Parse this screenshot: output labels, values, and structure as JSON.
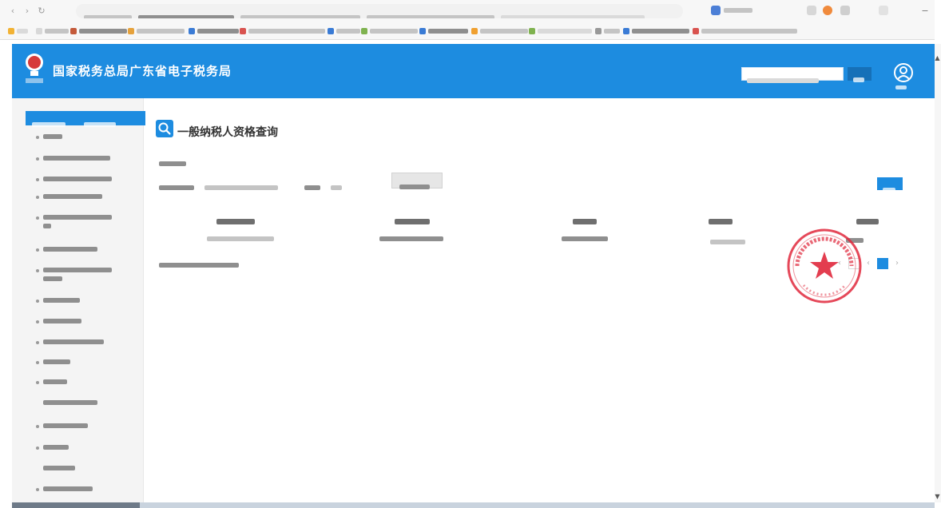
{
  "browser": {
    "url": "",
    "bookmarks": [
      "",
      "",
      "",
      "",
      "",
      "",
      "",
      "",
      "",
      "",
      "",
      "",
      "",
      ""
    ],
    "profile_label": ""
  },
  "header": {
    "title": "国家税务总局广东省电子税务局",
    "search_placeholder": "",
    "search_button": "",
    "user_label": ""
  },
  "sidebar": {
    "heading_left": "",
    "heading_right": "",
    "items": [
      "",
      "",
      "",
      "",
      "",
      "",
      "",
      "",
      "",
      "",
      "",
      "",
      "",
      "",
      "",
      "",
      "",
      "",
      ""
    ]
  },
  "page": {
    "title": "一般纳税人资格查询",
    "section_label": "",
    "field_1_label": "",
    "field_1_value": "",
    "field_2_label": "",
    "field_2_value": "",
    "query_button": "",
    "export_button": ""
  },
  "table": {
    "headers": [
      "",
      "",
      "",
      "",
      ""
    ],
    "rows": [
      [
        "",
        "",
        "",
        "",
        ""
      ]
    ]
  },
  "pager": {
    "info": ""
  },
  "colors": {
    "header_blue": "#1d8ce0",
    "seal_red": "#e0283c",
    "text_dark": "#333333",
    "sidebar_bg": "#f4f4f4"
  },
  "icons": [
    "back-icon",
    "forward-icon",
    "reload-icon",
    "star-icon",
    "search-icon",
    "user-icon",
    "seal-star-icon",
    "chevron-up-icon",
    "chevron-down-icon"
  ]
}
